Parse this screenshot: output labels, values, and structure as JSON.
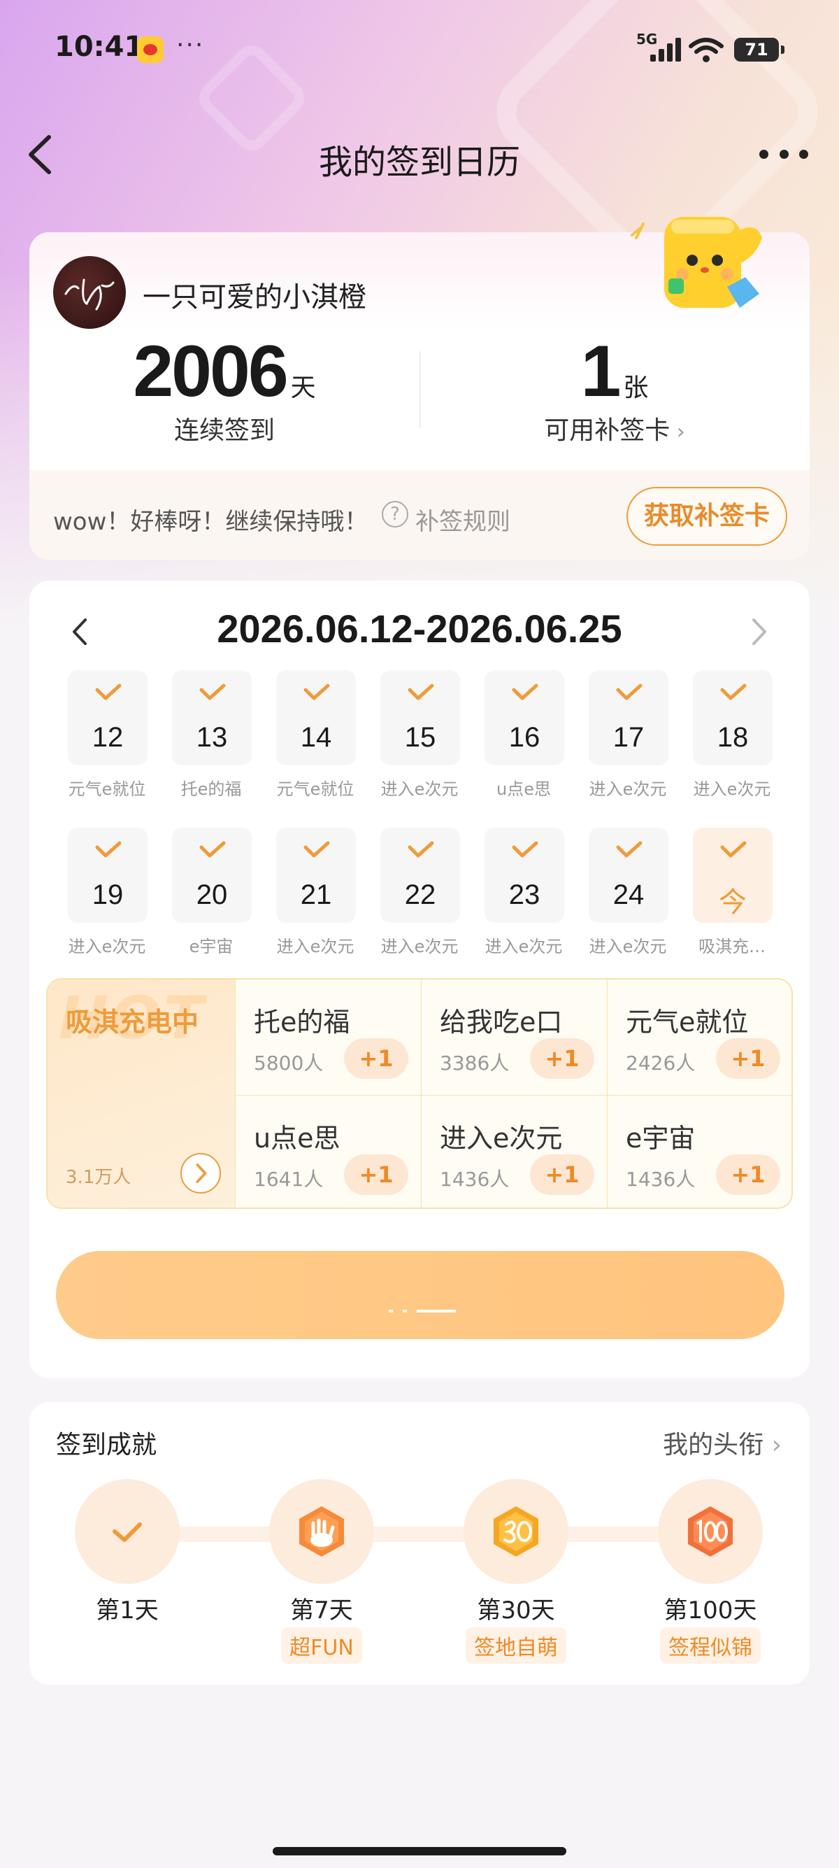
{
  "status_bar": {
    "time": "10:41",
    "dots": "···",
    "network": "5G",
    "battery": "71"
  },
  "nav": {
    "title": "我的签到日历"
  },
  "profile": {
    "username": "一只可爱的小淇橙",
    "streak_value": "2006",
    "streak_unit": "天",
    "streak_label": "连续签到",
    "cards_value": "1",
    "cards_unit": "张",
    "cards_label": "可用补签卡",
    "encourage_text": "wow！好棒呀！继续保持哦！",
    "rules_label": "补签规则",
    "get_card_label": "获取补签卡"
  },
  "calendar": {
    "range": "2026.06.12-2026.06.25",
    "days": [
      {
        "num": "12",
        "label": "元气e就位"
      },
      {
        "num": "13",
        "label": "托e的福"
      },
      {
        "num": "14",
        "label": "元气e就位"
      },
      {
        "num": "15",
        "label": "进入e次元"
      },
      {
        "num": "16",
        "label": "u点e思"
      },
      {
        "num": "17",
        "label": "进入e次元"
      },
      {
        "num": "18",
        "label": "进入e次元"
      },
      {
        "num": "19",
        "label": "进入e次元"
      },
      {
        "num": "20",
        "label": "e宇宙"
      },
      {
        "num": "21",
        "label": "进入e次元"
      },
      {
        "num": "22",
        "label": "进入e次元"
      },
      {
        "num": "23",
        "label": "进入e次元"
      },
      {
        "num": "24",
        "label": "进入e次元"
      },
      {
        "num": "今",
        "label": "吸淇充…"
      }
    ]
  },
  "activity": {
    "hot_watermark": "HOT",
    "hot_title": "吸淇充电中",
    "hot_count": "3.1万人",
    "items": [
      {
        "name": "托e的福",
        "count": "5800人",
        "plus": "+1"
      },
      {
        "name": "给我吃e口",
        "count": "3386人",
        "plus": "+1"
      },
      {
        "name": "元气e就位",
        "count": "2426人",
        "plus": "+1"
      },
      {
        "name": "u点e思",
        "count": "1641人",
        "plus": "+1"
      },
      {
        "name": "进入e次元",
        "count": "1436人",
        "plus": "+1"
      },
      {
        "name": "e宇宙",
        "count": "1436人",
        "plus": "+1"
      }
    ]
  },
  "achievements": {
    "title": "签到成就",
    "link_label": "我的头衔",
    "items": [
      {
        "day": "第1天",
        "tag": ""
      },
      {
        "day": "第7天",
        "tag": "超FUN"
      },
      {
        "day": "第30天",
        "tag": "签地自萌"
      },
      {
        "day": "第100天",
        "tag": "签程似锦"
      }
    ]
  },
  "colors": {
    "accent": "#ef9b3a",
    "button": "#ffc780"
  }
}
